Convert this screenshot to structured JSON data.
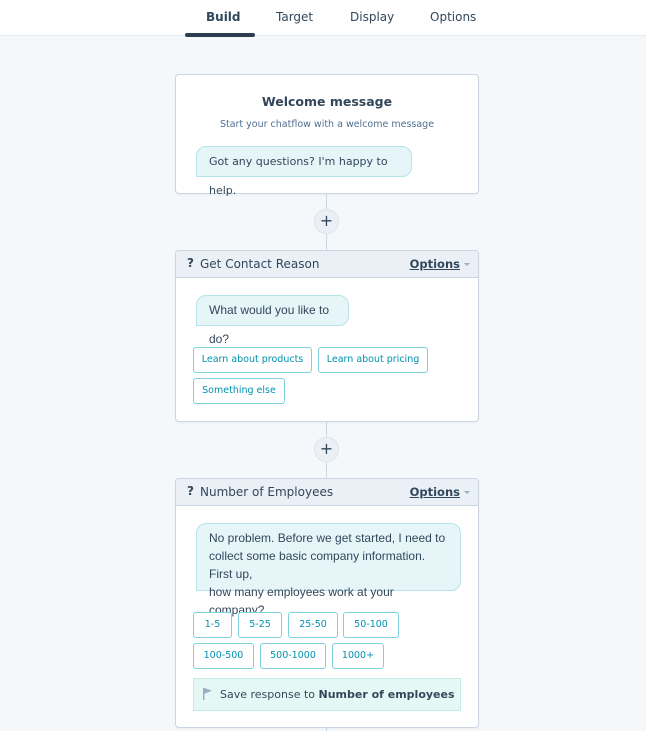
{
  "tabs": [
    {
      "label": "Build",
      "active": true
    },
    {
      "label": "Target",
      "active": false
    },
    {
      "label": "Display",
      "active": false
    },
    {
      "label": "Options",
      "active": false
    }
  ],
  "welcome": {
    "title": "Welcome message",
    "subtitle": "Start your chatflow with a welcome message",
    "message": "Got any questions? I'm happy to help."
  },
  "add_step_icon": "+",
  "contact_reason": {
    "icon": "?",
    "title": "Get Contact Reason",
    "options_label": "Options",
    "message": "What would you like to do?",
    "choices": [
      "Learn about products",
      "Learn about pricing",
      "Something else"
    ]
  },
  "employees": {
    "icon": "?",
    "title": "Number of Employees",
    "options_label": "Options",
    "message_lines": [
      "No problem. Before we get started, I need to",
      "collect some basic company information. First up,",
      "how many employees work at your company?"
    ],
    "choices": [
      "1-5",
      "5-25",
      "25-50",
      "50-100",
      "100-500",
      "500-1000",
      "1000+"
    ],
    "save_prefix": "Save response to",
    "save_property": "Number of employees"
  },
  "colors": {
    "accent_teal": "#0091ae",
    "nav_indicator": "#2d3e50",
    "bubble_bg": "#e5f5f8",
    "save_bg": "#e5f8f6"
  }
}
